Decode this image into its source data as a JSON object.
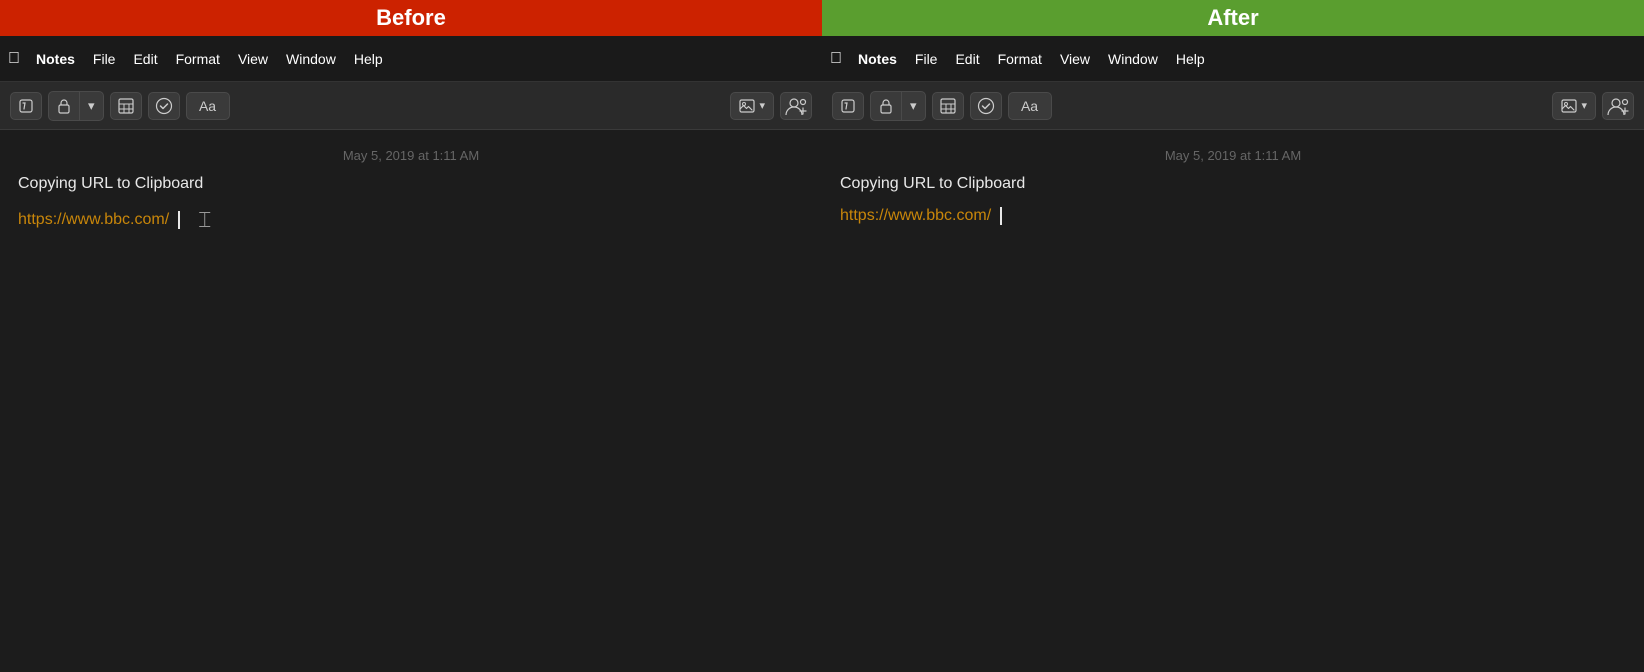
{
  "before": {
    "label": "Before",
    "label_class": "before",
    "menubar": {
      "notes": "Notes",
      "file": "File",
      "edit": "Edit",
      "format": "Format",
      "view": "View",
      "window": "Window",
      "help": "Help"
    },
    "toolbar": {
      "aa_label": "Aa",
      "img_label": "⊞",
      "img_dropdown": "▾"
    },
    "content": {
      "timestamp": "May 5, 2019 at 1:11 AM",
      "title": "Copying URL to Clipboard",
      "url": "https://www.bbc.com/"
    }
  },
  "after": {
    "label": "After",
    "label_class": "after",
    "menubar": {
      "notes": "Notes",
      "file": "File",
      "edit": "Edit",
      "format": "Format",
      "view": "View",
      "window": "Window",
      "help": "Help"
    },
    "toolbar": {
      "aa_label": "Aa",
      "img_label": "⊞",
      "img_dropdown": "▾"
    },
    "content": {
      "timestamp": "May 5, 2019 at 1:11 AM",
      "title": "Copying URL to Clipboard",
      "url": "https://www.bbc.com/"
    }
  }
}
